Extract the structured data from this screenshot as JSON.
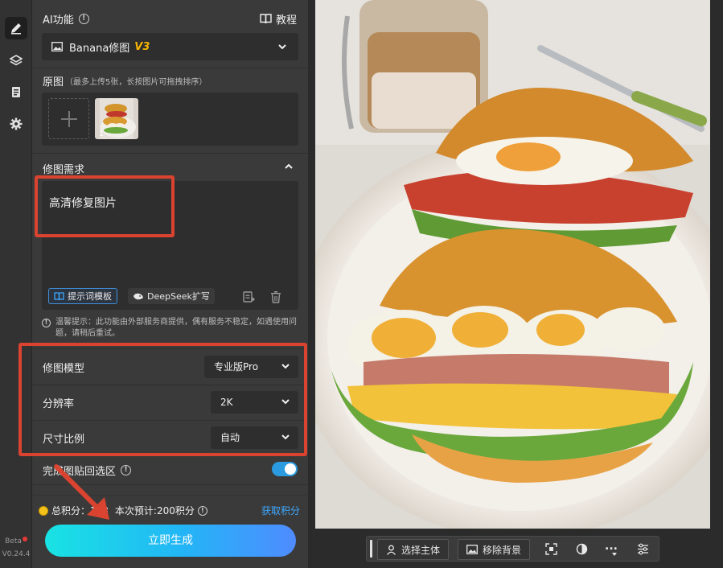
{
  "rail": {
    "items": [
      {
        "name": "edit",
        "icon": "pencil-icon",
        "active": true
      },
      {
        "name": "layers",
        "icon": "layers-icon",
        "active": false
      },
      {
        "name": "history",
        "icon": "clipboard-icon",
        "active": false
      },
      {
        "name": "settings",
        "icon": "gear-icon",
        "active": false
      }
    ],
    "beta_label": "Beta",
    "version": "V0.24.4"
  },
  "panel": {
    "ai_title": "AI功能",
    "tutorial_label": "教程",
    "model_select": {
      "name": "Banana修图",
      "badge": "V3"
    },
    "source": {
      "title": "原图",
      "hint": "（最多上传5张，长按图片可拖拽排序）",
      "thumb_index": "1"
    },
    "requirements": {
      "title": "修图需求",
      "prompt_value": "高清修复图片",
      "template_chip": "提示词模板",
      "deepseek_chip": "DeepSeek扩写"
    },
    "notice": "温馨提示：此功能由外部服务商提供，偶有服务不稳定，如遇使用问题，请稍后重试。",
    "settings": [
      {
        "label": "修图模型",
        "value": "专业版Pro"
      },
      {
        "label": "分辨率",
        "value": "2K"
      },
      {
        "label": "尺寸比例",
        "value": "自动"
      }
    ],
    "paste_back": {
      "label": "完成图贴回选区",
      "enabled": true
    },
    "credits": {
      "total_label": "总积分：138",
      "estimate_label": "本次预计:200积分",
      "get_label": "获取积分"
    },
    "generate_label": "立即生成"
  },
  "canvas": {
    "toolbar": {
      "select_subject": "选择主体",
      "remove_bg": "移除背景",
      "more": "..."
    }
  },
  "colors": {
    "accent_blue": "#3ea8ff",
    "highlight_red": "#d9432f",
    "badge_gold": "#f5b301"
  }
}
